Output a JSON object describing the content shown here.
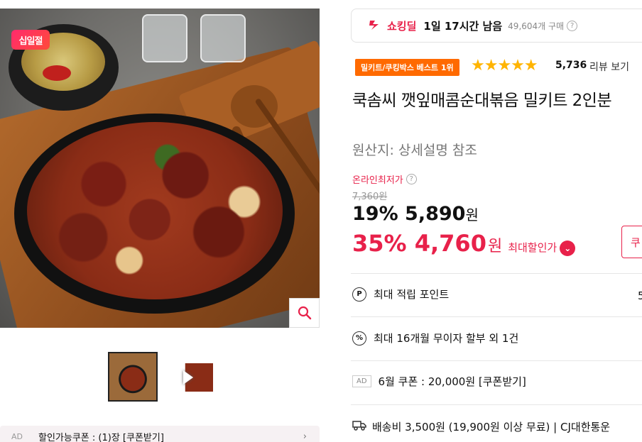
{
  "gallery": {
    "badge": "십일절",
    "zoom_icon": "search-icon",
    "thumbnails": [
      "product-thumbnail",
      "video-thumbnail"
    ]
  },
  "coupon_bar": {
    "ad": "AD",
    "text": "할인가능쿠폰 : (1)장 [쿠폰받기]",
    "arrow": "›"
  },
  "deal": {
    "label": "쇼킹딜",
    "time_left": "1일 17시간 남음",
    "sales": "49,604개 구매"
  },
  "rating": {
    "badge": "밀키트/쿠킹박스 베스트 1위",
    "stars": "★★★★★",
    "score": 4.7,
    "count": "5,736",
    "review_link": "리뷰 보기"
  },
  "product": {
    "title": "쿡솜씨 깻잎매콤순대볶음 밀키트 2인분",
    "origin": "원산지: 상세설명 참조"
  },
  "price": {
    "lowest_label": "온라인최저가",
    "original": "7,360원",
    "discount1_rate": "19%",
    "discount1_price": "5,890",
    "won": "원",
    "discount2_rate": "35%",
    "discount2_price": "4,760",
    "max_discount_label": "최대할인가",
    "coupon_button": "쿠"
  },
  "benefits": {
    "points_icon": "P",
    "points": "최대 적립 포인트",
    "installment_icon": "%",
    "installment": "최대 16개월 무이자 할부 외 1건",
    "coupon_ad": "AD",
    "coupon": "6월 쿠폰 : 20,000원 [쿠폰받기]",
    "shipping": "배송비 3,500원 (19,900원 이상 무료) | CJ대한통운",
    "points_edge": "5"
  },
  "colors": {
    "accent": "#e8214a",
    "best_badge": "#ff6a00",
    "star": "#ffb400"
  }
}
